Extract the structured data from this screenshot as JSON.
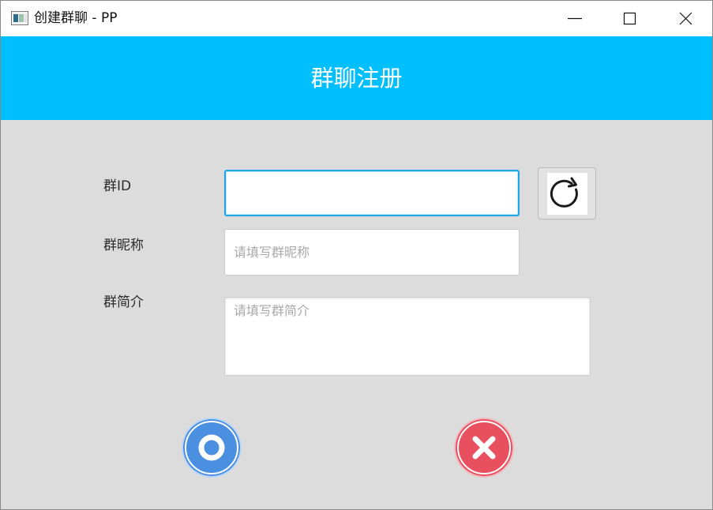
{
  "window": {
    "title": "创建群聊 - PP",
    "controls": [
      "minimize-icon",
      "maximize-icon",
      "close-icon"
    ]
  },
  "header": {
    "title": "群聊注册",
    "background": "#00bfff"
  },
  "form": {
    "group_id": {
      "label": "群ID",
      "value": "",
      "placeholder": ""
    },
    "group_nickname": {
      "label": "群昵称",
      "value": "",
      "placeholder": "请填写群昵称"
    },
    "group_intro": {
      "label": "群简介",
      "value": "",
      "placeholder": "请填写群简介"
    },
    "refresh_icon": "refresh-icon"
  },
  "actions": {
    "confirm": {
      "icon": "circle-ok-icon",
      "color": "#4a8fe0"
    },
    "cancel": {
      "icon": "close-circle-icon",
      "color": "#e8505f"
    }
  }
}
